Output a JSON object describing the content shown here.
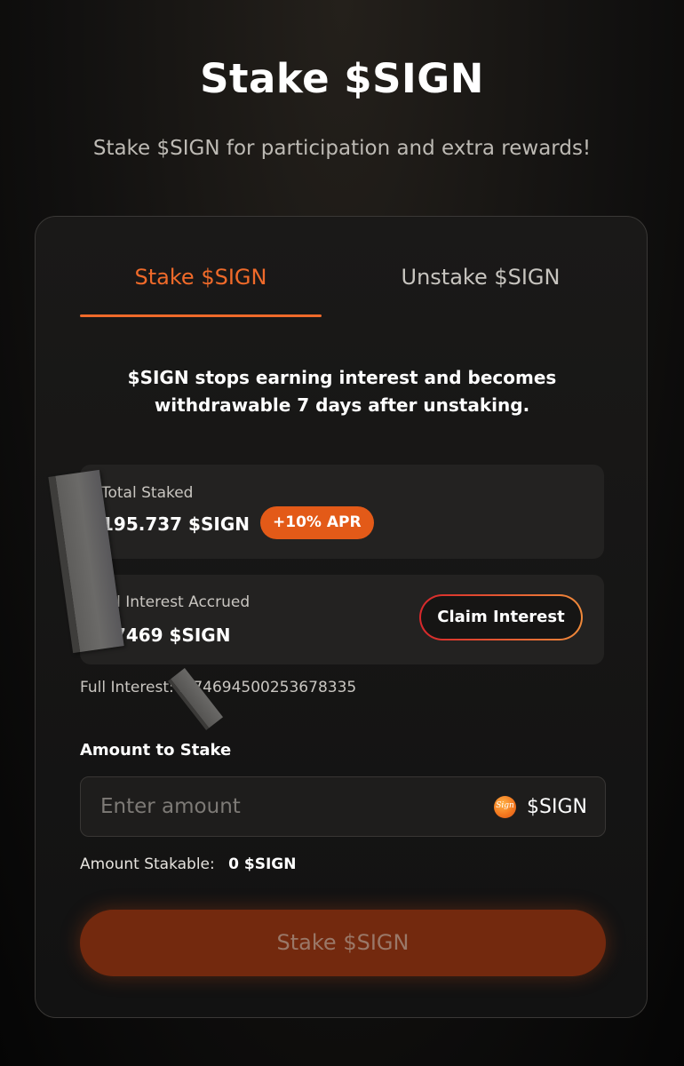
{
  "header": {
    "title": "Stake $SIGN",
    "subtitle": "Stake $SIGN for participation and extra rewards!"
  },
  "tabs": [
    {
      "label": "Stake $SIGN",
      "active": true
    },
    {
      "label": "Unstake $SIGN",
      "active": false
    }
  ],
  "notice": "$SIGN stops earning interest and becomes withdrawable 7 days after unstaking.",
  "total_staked": {
    "label": "Total Staked",
    "value": "195.737 $SIGN",
    "apr_badge": "+10% APR"
  },
  "interest": {
    "label": "tal Interest Accrued",
    "value": "47469 $SIGN",
    "claim_label": "Claim Interest"
  },
  "full_interest": "Full Interest: .474694500253678335",
  "amount": {
    "label": "Amount to Stake",
    "placeholder": "Enter amount",
    "value": "",
    "token_symbol": "$SIGN",
    "token_icon_text": "Sign"
  },
  "stakable": {
    "label": "Amount Stakable:",
    "value": "0 $SIGN"
  },
  "stake_button_label": "Stake $SIGN",
  "colors": {
    "accent": "#f06a2a",
    "badge": "#e35a18",
    "disabled_button": "#73290e"
  }
}
